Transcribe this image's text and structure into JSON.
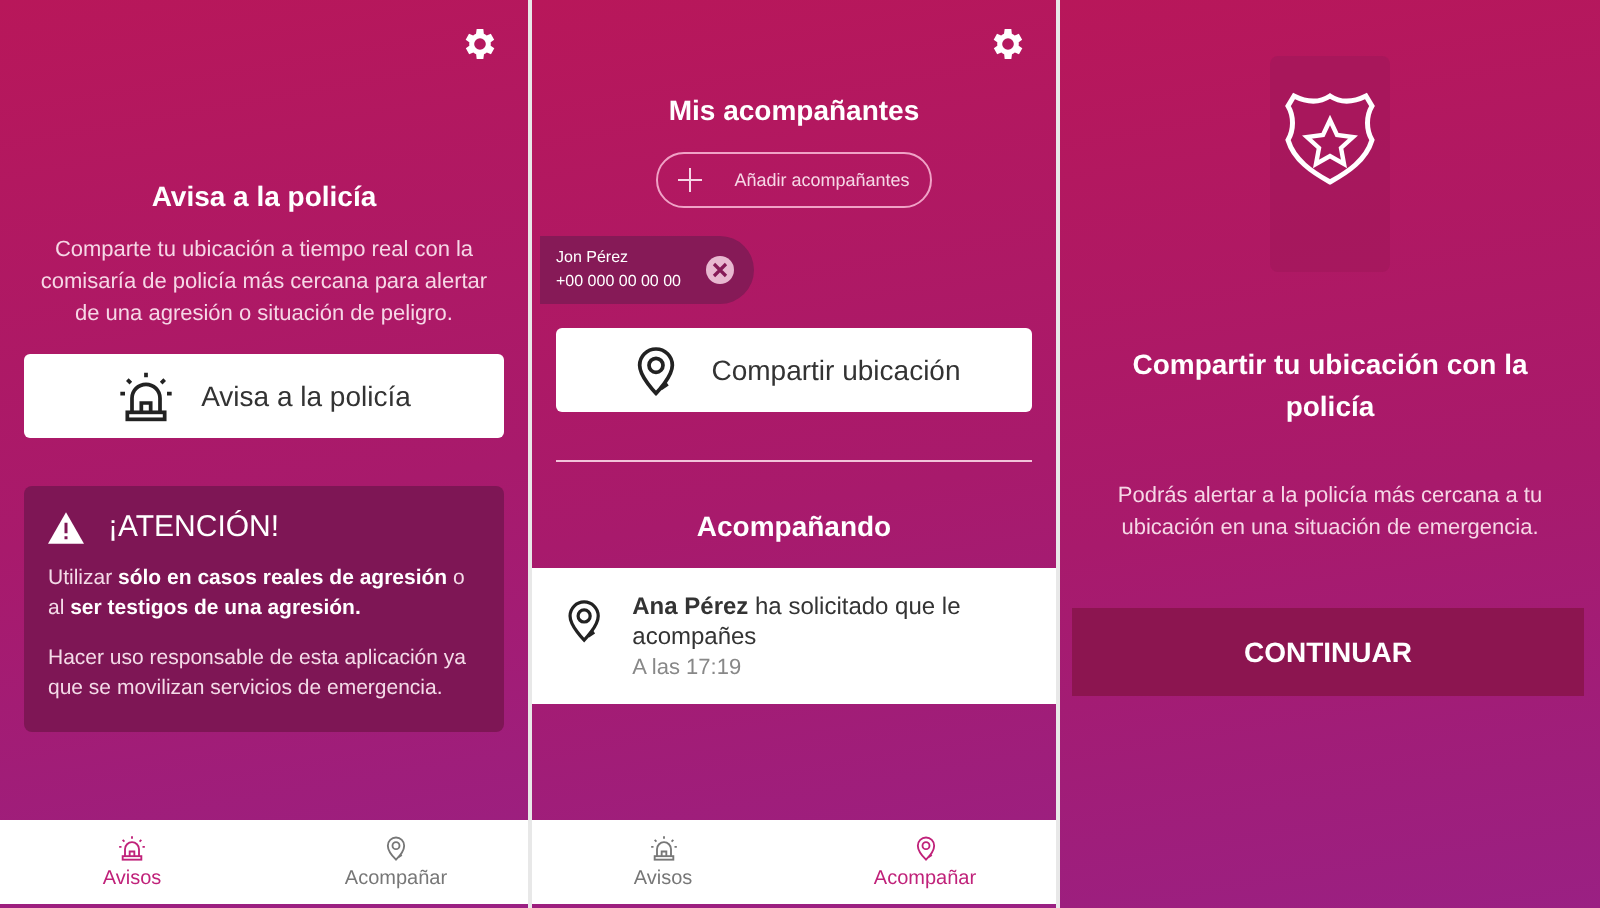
{
  "screens": [
    {
      "kind": "alert",
      "title": "Avisa a la policía",
      "description": "Comparte tu ubicación a tiempo real con la comisaría de policía más cercana para alertar de una agresión o situación de peligro.",
      "button": "Avisa a la policía",
      "warning": {
        "title": "¡ATENCIÓN!",
        "paragraphs": [
          "Utilizar **sólo en casos reales de agresión** o al **ser testigos de una agresión.**",
          "Hacer uso responsable de esta aplicación ya que se movilizan servicios de emergencia."
        ]
      },
      "nav": [
        {
          "label": "Avisos",
          "kind": "siren",
          "selected": true
        },
        {
          "label": "Acompañar",
          "kind": "pin",
          "selected": false
        }
      ]
    },
    {
      "kind": "companions",
      "title": "Mis acompañantes",
      "add_button": "Añadir acompañantes",
      "contacts": [
        {
          "name": "Jon Pérez",
          "phone": "+00 000 00 00 00"
        }
      ],
      "button": "Compartir ubicación",
      "section_title": "Acompañando",
      "requests": [
        {
          "text": "**Ana Pérez** ha solicitado que le acompañes",
          "time": "A las 17:19"
        }
      ],
      "nav": [
        {
          "label": "Avisos",
          "kind": "siren",
          "selected": false
        },
        {
          "label": "Acompañar",
          "kind": "pin",
          "selected": true
        }
      ]
    },
    {
      "kind": "onboarding",
      "title": "Compartir tu ubicación con la policía",
      "description": "Podrás alertar a la policía más cercana a tu ubicación en una situación de emergencia.",
      "button": "CONTINUAR"
    }
  ]
}
